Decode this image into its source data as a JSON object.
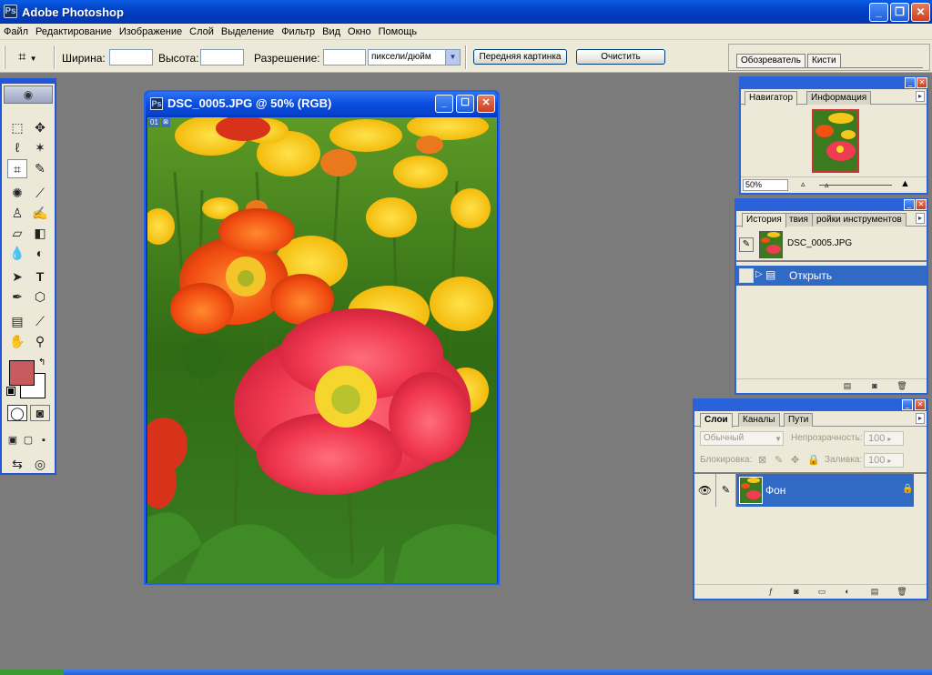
{
  "app": {
    "title": "Adobe Photoshop",
    "icon": "photoshop-icon"
  },
  "window_controls": {
    "minimize": "_",
    "restore": "❐",
    "close": "✕"
  },
  "menu": [
    "Файл",
    "Редактирование",
    "Изображение",
    "Слой",
    "Выделение",
    "Фильтр",
    "Вид",
    "Окно",
    "Помощь"
  ],
  "options": {
    "width_label": "Ширина:",
    "width_value": "",
    "height_label": "Высота:",
    "height_value": "",
    "resolution_label": "Разрешение:",
    "resolution_value": "",
    "units_value": "пиксели/дюйм",
    "front_image_label": "Передняя картинка",
    "clear_label": "Очистить"
  },
  "palette_well": {
    "tabs": [
      "Обозреватель",
      "Кисти"
    ]
  },
  "document": {
    "title": "DSC_0005.JPG @ 50% (RGB)",
    "slice_badge": "01"
  },
  "navigator": {
    "tabs": [
      "Навигатор",
      "Информация"
    ],
    "zoom": "50%"
  },
  "history": {
    "tabs": [
      "История",
      "твия",
      "ройки инструментов"
    ],
    "snapshot_name": "DSC_0005.JPG",
    "step": "Открыть"
  },
  "layers": {
    "tabs": [
      "Слои",
      "Каналы",
      "Пути"
    ],
    "blend_mode": "Обычный",
    "opacity_label": "Непрозрачность:",
    "opacity_value": "100",
    "lock_label": "Блокировка:",
    "fill_label": "Заливка:",
    "fill_value": "100",
    "layer_name": "Фон"
  },
  "colors": {
    "foreground": "#c75a5d",
    "background": "#ffffff",
    "accent": "#2a62d9",
    "selection": "#316ac5"
  }
}
